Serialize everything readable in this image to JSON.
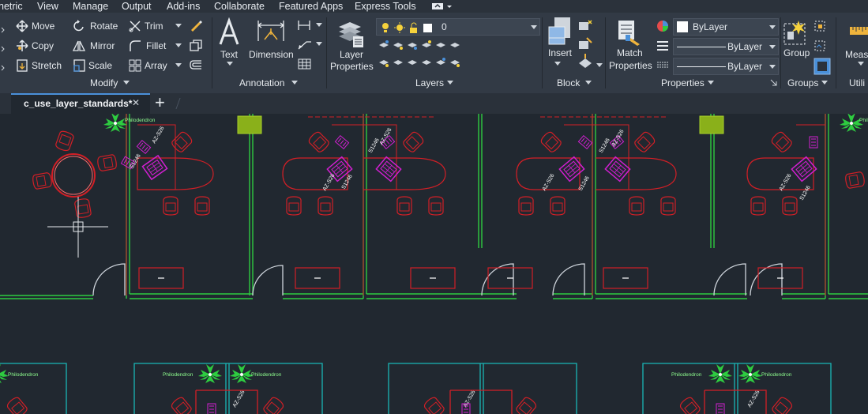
{
  "menu": [
    "netric",
    "View",
    "Manage",
    "Output",
    "Add-ins",
    "Collaborate",
    "Featured Apps",
    "Express Tools"
  ],
  "modify": {
    "title": "Modify",
    "move": "Move",
    "rotate": "Rotate",
    "trim": "Trim",
    "copy": "Copy",
    "mirror": "Mirror",
    "fillet": "Fillet",
    "stretch": "Stretch",
    "scale": "Scale",
    "array": "Array"
  },
  "annotation": {
    "title": "Annotation",
    "text": "Text",
    "dimension": "Dimension"
  },
  "layers": {
    "title": "Layers",
    "properties": [
      "Layer",
      "Properties"
    ],
    "current_layer": "0"
  },
  "block": {
    "title": "Block",
    "insert": "Insert"
  },
  "properties": {
    "title": "Properties",
    "match": [
      "Match",
      "Properties"
    ],
    "color": "ByLayer",
    "linetype": "ByLayer",
    "lineweight": "ByLayer"
  },
  "groups": {
    "title": "Groups",
    "group": "Group"
  },
  "utilities": {
    "title": "Utili",
    "measure": "Measu"
  },
  "tabs": {
    "active": "c_use_layer_standards*",
    "close": "✕",
    "new": "+"
  },
  "plant_label": "Philodendron",
  "colors": {
    "background": "#212830",
    "walls": "#2ecc40",
    "furniture": "#d21f26",
    "equipment": "#d21fd2",
    "plants": "#2ecc40",
    "plant_text": "#8fff8f",
    "cyan": "#19b6b6",
    "tab_accent": "#4a90d9"
  }
}
